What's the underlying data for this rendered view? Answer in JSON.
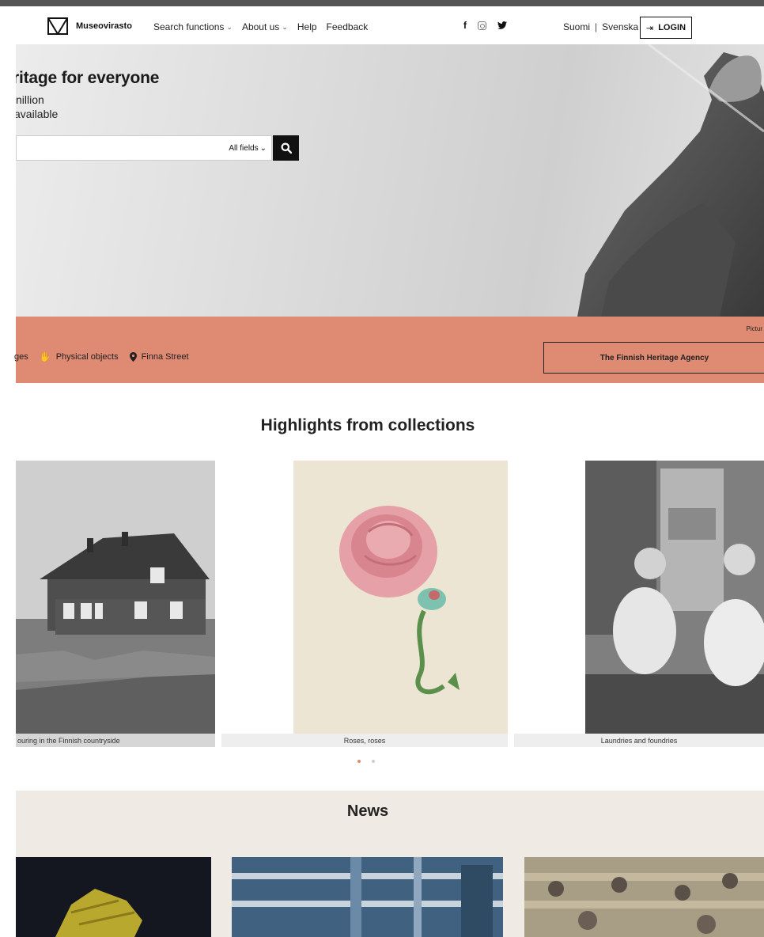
{
  "header": {
    "logo_text": "Museovirasto",
    "nav": [
      {
        "label": "Search functions",
        "has_menu": true
      },
      {
        "label": "About us",
        "has_menu": true
      },
      {
        "label": "Help",
        "has_menu": false
      },
      {
        "label": "Feedback",
        "has_menu": false
      }
    ],
    "social": [
      "facebook-icon",
      "instagram-icon",
      "twitter-icon"
    ],
    "languages": [
      "Suomi",
      "Svenska"
    ],
    "login_label": "LOGIN"
  },
  "hero": {
    "title": "ritage for everyone",
    "subtitle_line1": "nillion",
    "subtitle_line2": "available",
    "search": {
      "value": "",
      "scope": "All fields"
    }
  },
  "band": {
    "credit": "Pictur",
    "links": [
      {
        "label": "ges",
        "icon": ""
      },
      {
        "label": "Physical objects",
        "icon": "hand-icon"
      },
      {
        "label": "Finna Street",
        "icon": "map-pin-icon"
      }
    ],
    "agency_button": "The Finnish Heritage Agency"
  },
  "highlights": {
    "title": "Highlights from collections",
    "cards": [
      {
        "caption": "ouring in the Finnish countryside"
      },
      {
        "caption": "Roses, roses"
      },
      {
        "caption": "Laundries and foundries"
      }
    ],
    "carousel_page": 1,
    "carousel_pages": 2
  },
  "news": {
    "title": "News"
  },
  "colors": {
    "accent": "#df8a73",
    "news_bg": "#efebe4"
  }
}
